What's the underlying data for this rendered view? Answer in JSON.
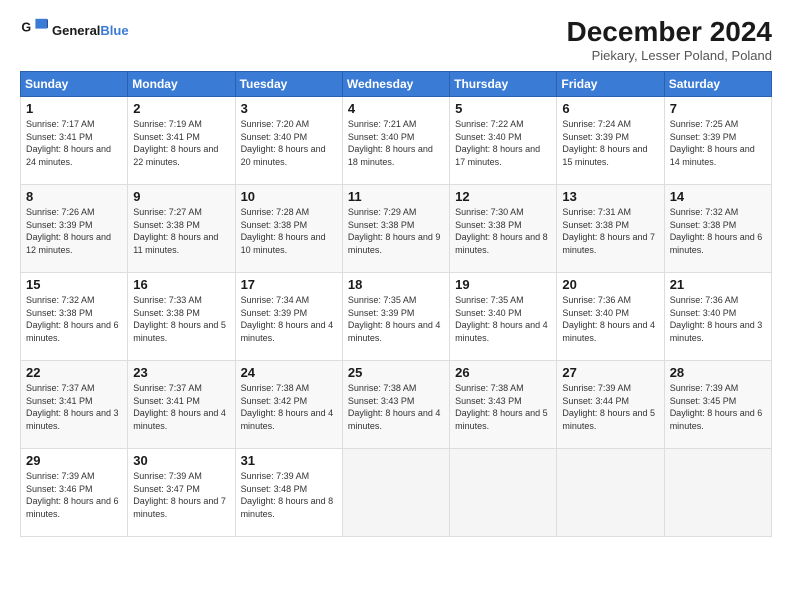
{
  "logo": {
    "line1": "General",
    "line2": "Blue"
  },
  "title": "December 2024",
  "subtitle": "Piekary, Lesser Poland, Poland",
  "days_header": [
    "Sunday",
    "Monday",
    "Tuesday",
    "Wednesday",
    "Thursday",
    "Friday",
    "Saturday"
  ],
  "weeks": [
    [
      {
        "day": "1",
        "sunrise": "7:17 AM",
        "sunset": "3:41 PM",
        "daylight": "8 hours and 24 minutes."
      },
      {
        "day": "2",
        "sunrise": "7:19 AM",
        "sunset": "3:41 PM",
        "daylight": "8 hours and 22 minutes."
      },
      {
        "day": "3",
        "sunrise": "7:20 AM",
        "sunset": "3:40 PM",
        "daylight": "8 hours and 20 minutes."
      },
      {
        "day": "4",
        "sunrise": "7:21 AM",
        "sunset": "3:40 PM",
        "daylight": "8 hours and 18 minutes."
      },
      {
        "day": "5",
        "sunrise": "7:22 AM",
        "sunset": "3:40 PM",
        "daylight": "8 hours and 17 minutes."
      },
      {
        "day": "6",
        "sunrise": "7:24 AM",
        "sunset": "3:39 PM",
        "daylight": "8 hours and 15 minutes."
      },
      {
        "day": "7",
        "sunrise": "7:25 AM",
        "sunset": "3:39 PM",
        "daylight": "8 hours and 14 minutes."
      }
    ],
    [
      {
        "day": "8",
        "sunrise": "7:26 AM",
        "sunset": "3:39 PM",
        "daylight": "8 hours and 12 minutes."
      },
      {
        "day": "9",
        "sunrise": "7:27 AM",
        "sunset": "3:38 PM",
        "daylight": "8 hours and 11 minutes."
      },
      {
        "day": "10",
        "sunrise": "7:28 AM",
        "sunset": "3:38 PM",
        "daylight": "8 hours and 10 minutes."
      },
      {
        "day": "11",
        "sunrise": "7:29 AM",
        "sunset": "3:38 PM",
        "daylight": "8 hours and 9 minutes."
      },
      {
        "day": "12",
        "sunrise": "7:30 AM",
        "sunset": "3:38 PM",
        "daylight": "8 hours and 8 minutes."
      },
      {
        "day": "13",
        "sunrise": "7:31 AM",
        "sunset": "3:38 PM",
        "daylight": "8 hours and 7 minutes."
      },
      {
        "day": "14",
        "sunrise": "7:32 AM",
        "sunset": "3:38 PM",
        "daylight": "8 hours and 6 minutes."
      }
    ],
    [
      {
        "day": "15",
        "sunrise": "7:32 AM",
        "sunset": "3:38 PM",
        "daylight": "8 hours and 6 minutes."
      },
      {
        "day": "16",
        "sunrise": "7:33 AM",
        "sunset": "3:38 PM",
        "daylight": "8 hours and 5 minutes."
      },
      {
        "day": "17",
        "sunrise": "7:34 AM",
        "sunset": "3:39 PM",
        "daylight": "8 hours and 4 minutes."
      },
      {
        "day": "18",
        "sunrise": "7:35 AM",
        "sunset": "3:39 PM",
        "daylight": "8 hours and 4 minutes."
      },
      {
        "day": "19",
        "sunrise": "7:35 AM",
        "sunset": "3:40 PM",
        "daylight": "8 hours and 4 minutes."
      },
      {
        "day": "20",
        "sunrise": "7:36 AM",
        "sunset": "3:40 PM",
        "daylight": "8 hours and 4 minutes."
      },
      {
        "day": "21",
        "sunrise": "7:36 AM",
        "sunset": "3:40 PM",
        "daylight": "8 hours and 3 minutes."
      }
    ],
    [
      {
        "day": "22",
        "sunrise": "7:37 AM",
        "sunset": "3:41 PM",
        "daylight": "8 hours and 3 minutes."
      },
      {
        "day": "23",
        "sunrise": "7:37 AM",
        "sunset": "3:41 PM",
        "daylight": "8 hours and 4 minutes."
      },
      {
        "day": "24",
        "sunrise": "7:38 AM",
        "sunset": "3:42 PM",
        "daylight": "8 hours and 4 minutes."
      },
      {
        "day": "25",
        "sunrise": "7:38 AM",
        "sunset": "3:43 PM",
        "daylight": "8 hours and 4 minutes."
      },
      {
        "day": "26",
        "sunrise": "7:38 AM",
        "sunset": "3:43 PM",
        "daylight": "8 hours and 5 minutes."
      },
      {
        "day": "27",
        "sunrise": "7:39 AM",
        "sunset": "3:44 PM",
        "daylight": "8 hours and 5 minutes."
      },
      {
        "day": "28",
        "sunrise": "7:39 AM",
        "sunset": "3:45 PM",
        "daylight": "8 hours and 6 minutes."
      }
    ],
    [
      {
        "day": "29",
        "sunrise": "7:39 AM",
        "sunset": "3:46 PM",
        "daylight": "8 hours and 6 minutes."
      },
      {
        "day": "30",
        "sunrise": "7:39 AM",
        "sunset": "3:47 PM",
        "daylight": "8 hours and 7 minutes."
      },
      {
        "day": "31",
        "sunrise": "7:39 AM",
        "sunset": "3:48 PM",
        "daylight": "8 hours and 8 minutes."
      },
      null,
      null,
      null,
      null
    ]
  ]
}
